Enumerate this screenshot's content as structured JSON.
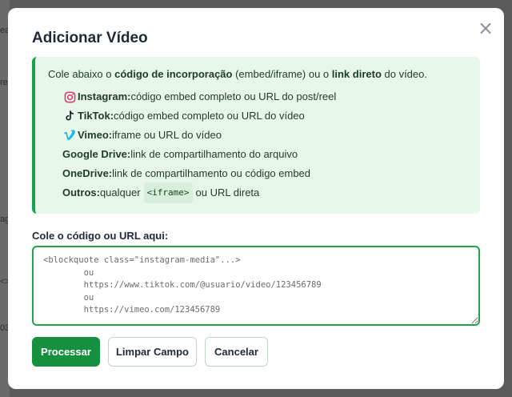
{
  "backdrop": {
    "fragments": [
      "ea",
      "re",
      "ag",
      "<>",
      "03"
    ]
  },
  "modal": {
    "title": "Adicionar Vídeo",
    "close_label": "×"
  },
  "info": {
    "intro_prefix": "Cole abaixo o ",
    "intro_bold1": "código de incorporação",
    "intro_middle": " (embed/iframe) ou o ",
    "intro_bold2": "link direto",
    "intro_suffix": " do vídeo.",
    "platforms": [
      {
        "name": "Instagram:",
        "desc": "código embed completo ou URL do post/reel",
        "icon": "instagram-icon"
      },
      {
        "name": "TikTok:",
        "desc": "código embed completo ou URL do vídeo",
        "icon": "tiktok-icon"
      },
      {
        "name": "Vimeo:",
        "desc": "iframe ou URL do vídeo",
        "icon": "vimeo-icon"
      },
      {
        "name": "Google Drive:",
        "desc": "link de compartilhamento do arquivo"
      },
      {
        "name": "OneDrive:",
        "desc": "link de compartilhamento ou código embed"
      },
      {
        "name": "Outros:",
        "desc_before": "qualquer",
        "code": "<iframe>",
        "desc_after": "ou URL direta"
      }
    ]
  },
  "field": {
    "label": "Cole o código ou URL aqui:",
    "placeholder": "<blockquote class=\"instagram-media\"...>\n        ou\n        https://www.tiktok.com/@usuario/video/123456789\n        ou\n        https://vimeo.com/123456789",
    "value": ""
  },
  "buttons": {
    "process": "Processar",
    "clear": "Limpar Campo",
    "cancel": "Cancelar"
  },
  "colors": {
    "accent": "#15903f",
    "info_bg": "#e8f7ec",
    "info_border": "#16a34a",
    "instagram": "#e1306c",
    "vimeo": "#1ab7ea"
  }
}
